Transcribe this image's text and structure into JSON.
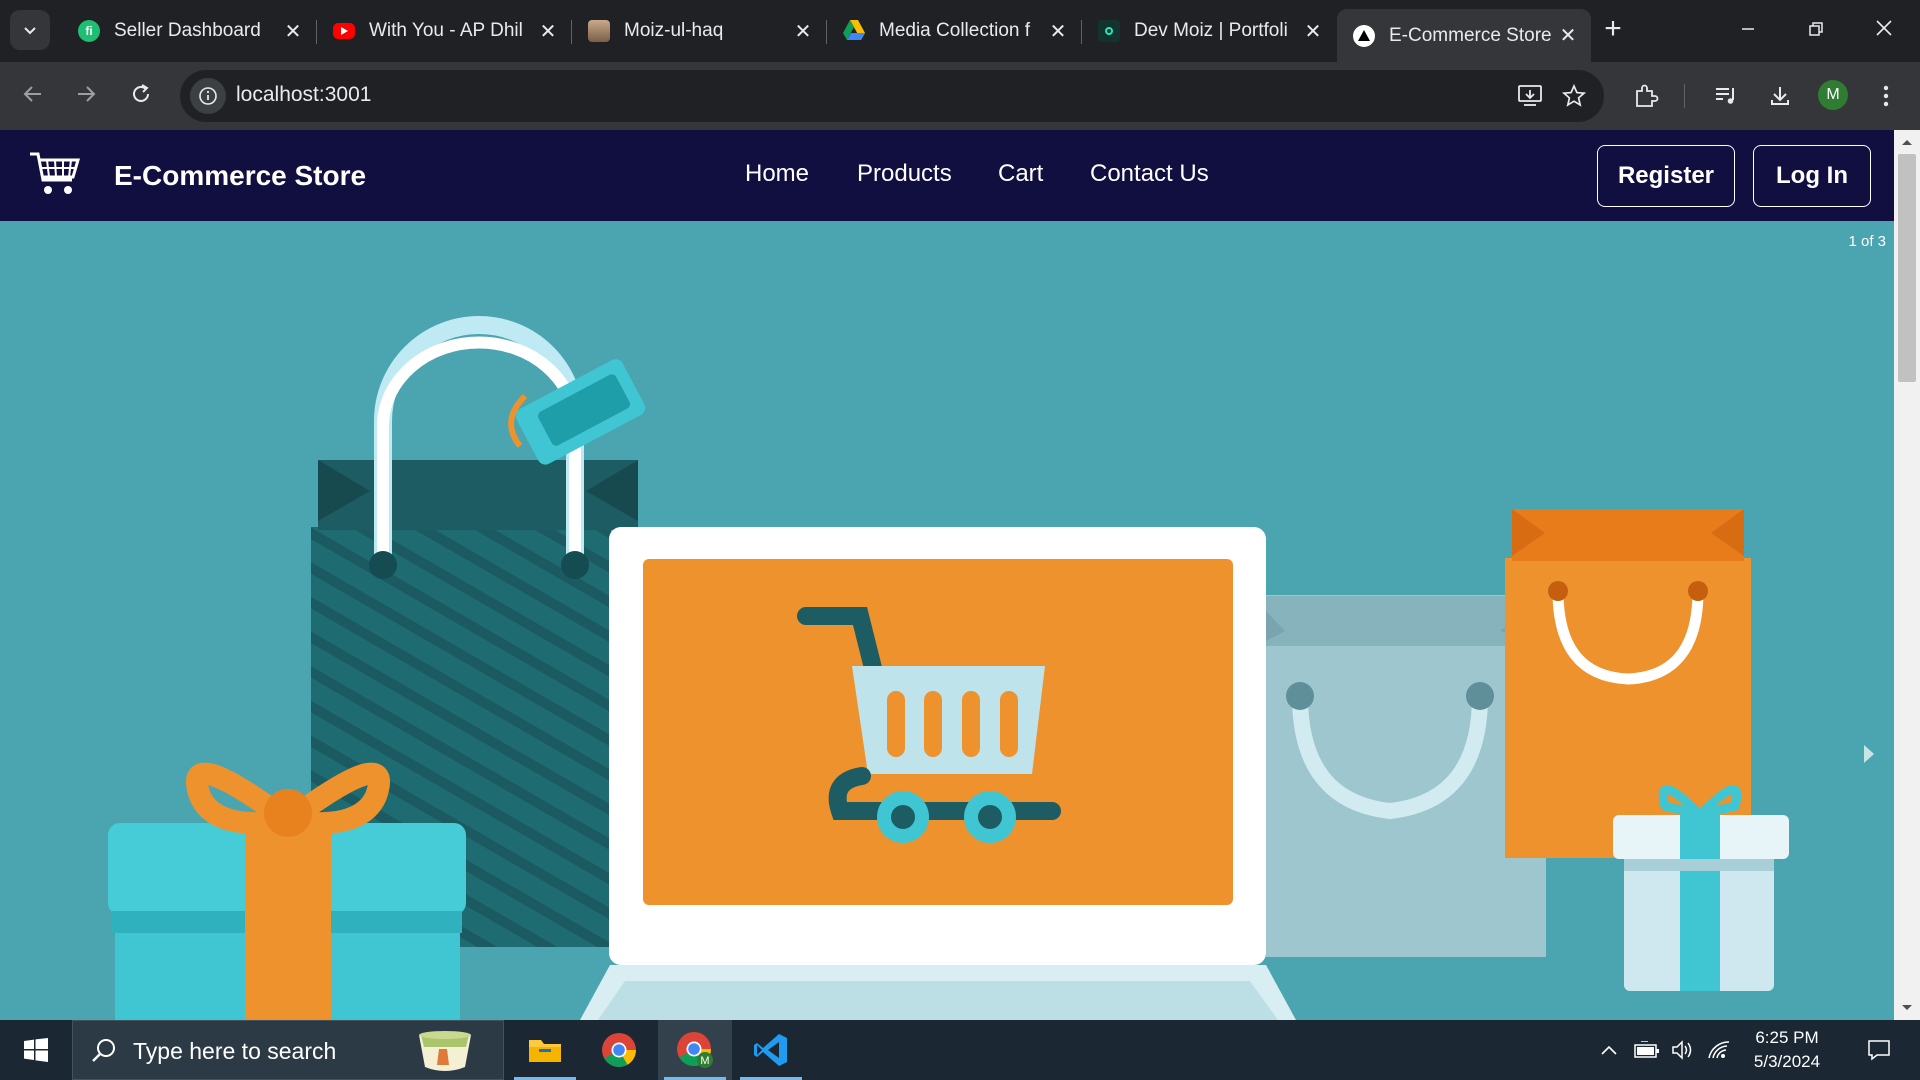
{
  "browser": {
    "tabs": [
      {
        "title": "Seller Dashboard",
        "favicon": "fiverr-icon",
        "color": "#1dbf73"
      },
      {
        "title": "With You - AP Dhil",
        "favicon": "youtube-icon",
        "color": "#ff0000"
      },
      {
        "title": "Moiz-ul-haq",
        "favicon": "profile-photo-icon",
        "color": "#8d6e63"
      },
      {
        "title": "Media Collection f",
        "favicon": "google-drive-icon",
        "color": "#fbbc04"
      },
      {
        "title": "Dev Moiz | Portfoli",
        "favicon": "portfolio-icon",
        "color": "#1de9b6"
      },
      {
        "title": "E-Commerce Store",
        "favicon": "triangle-logo-icon",
        "color": "#ffffff"
      }
    ],
    "active_tab_index": 5,
    "url": "localhost:3001",
    "profile_initial": "M"
  },
  "site": {
    "brand": "E-Commerce Store",
    "nav": [
      "Home",
      "Products",
      "Cart",
      "Contact Us"
    ],
    "register_label": "Register",
    "login_label": "Log In",
    "slide_counter": "1 of 3",
    "colors": {
      "header_bg": "#100f40",
      "hero_bg": "#4aa5b0",
      "accent_orange": "#ee922d",
      "teal": "#3fc6d2"
    }
  },
  "taskbar": {
    "search_placeholder": "Type here to search",
    "time": "6:25 PM",
    "date": "5/3/2024",
    "apps": [
      "file-explorer-icon",
      "chrome-icon",
      "chrome-profile-icon",
      "vscode-icon"
    ]
  }
}
